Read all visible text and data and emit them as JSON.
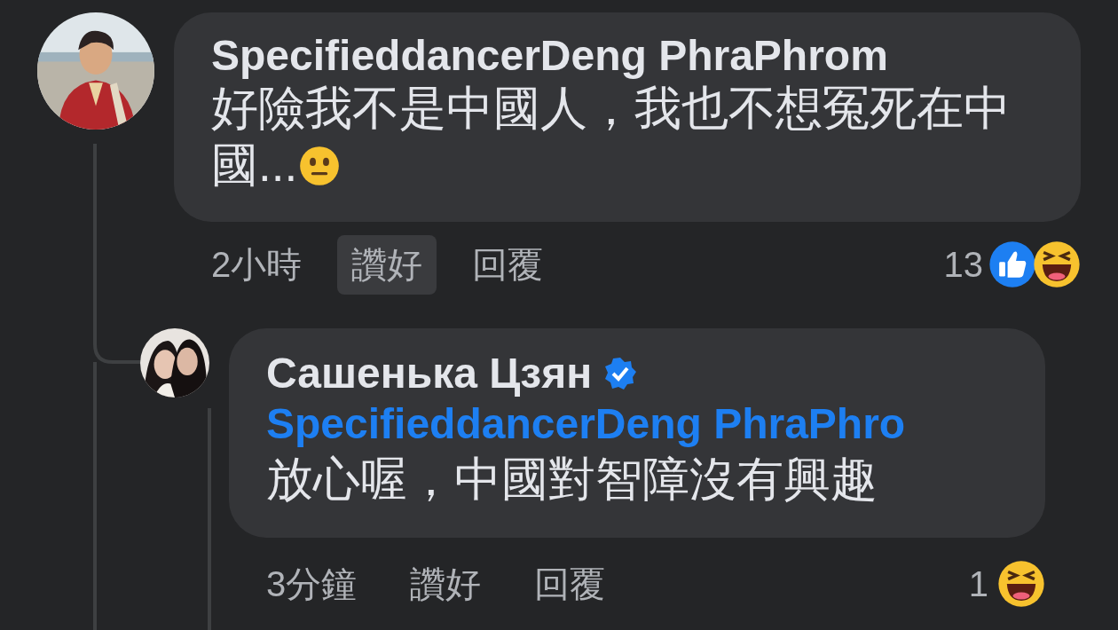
{
  "comments": [
    {
      "author": "SpecifieddancerDeng PhraPhrom",
      "verified": false,
      "text": "好險我不是中國人，我也不想冤死在中國...",
      "time": "2小時",
      "like_label": "讚好",
      "liked": true,
      "reply_label": "回覆",
      "reaction_count": "13",
      "reactions": [
        {
          "kind": "like"
        },
        {
          "kind": "haha"
        }
      ],
      "replies": [
        {
          "author": "Сашенька Цзян",
          "verified": true,
          "mention": "SpecifieddancerDeng PhraPhro",
          "text": "放心喔，中國對智障沒有興趣",
          "time": "3分鐘",
          "like_label": "讚好",
          "liked": false,
          "reply_label": "回覆",
          "reaction_count": "1",
          "reactions": [
            {
              "kind": "haha"
            }
          ]
        }
      ]
    }
  ]
}
